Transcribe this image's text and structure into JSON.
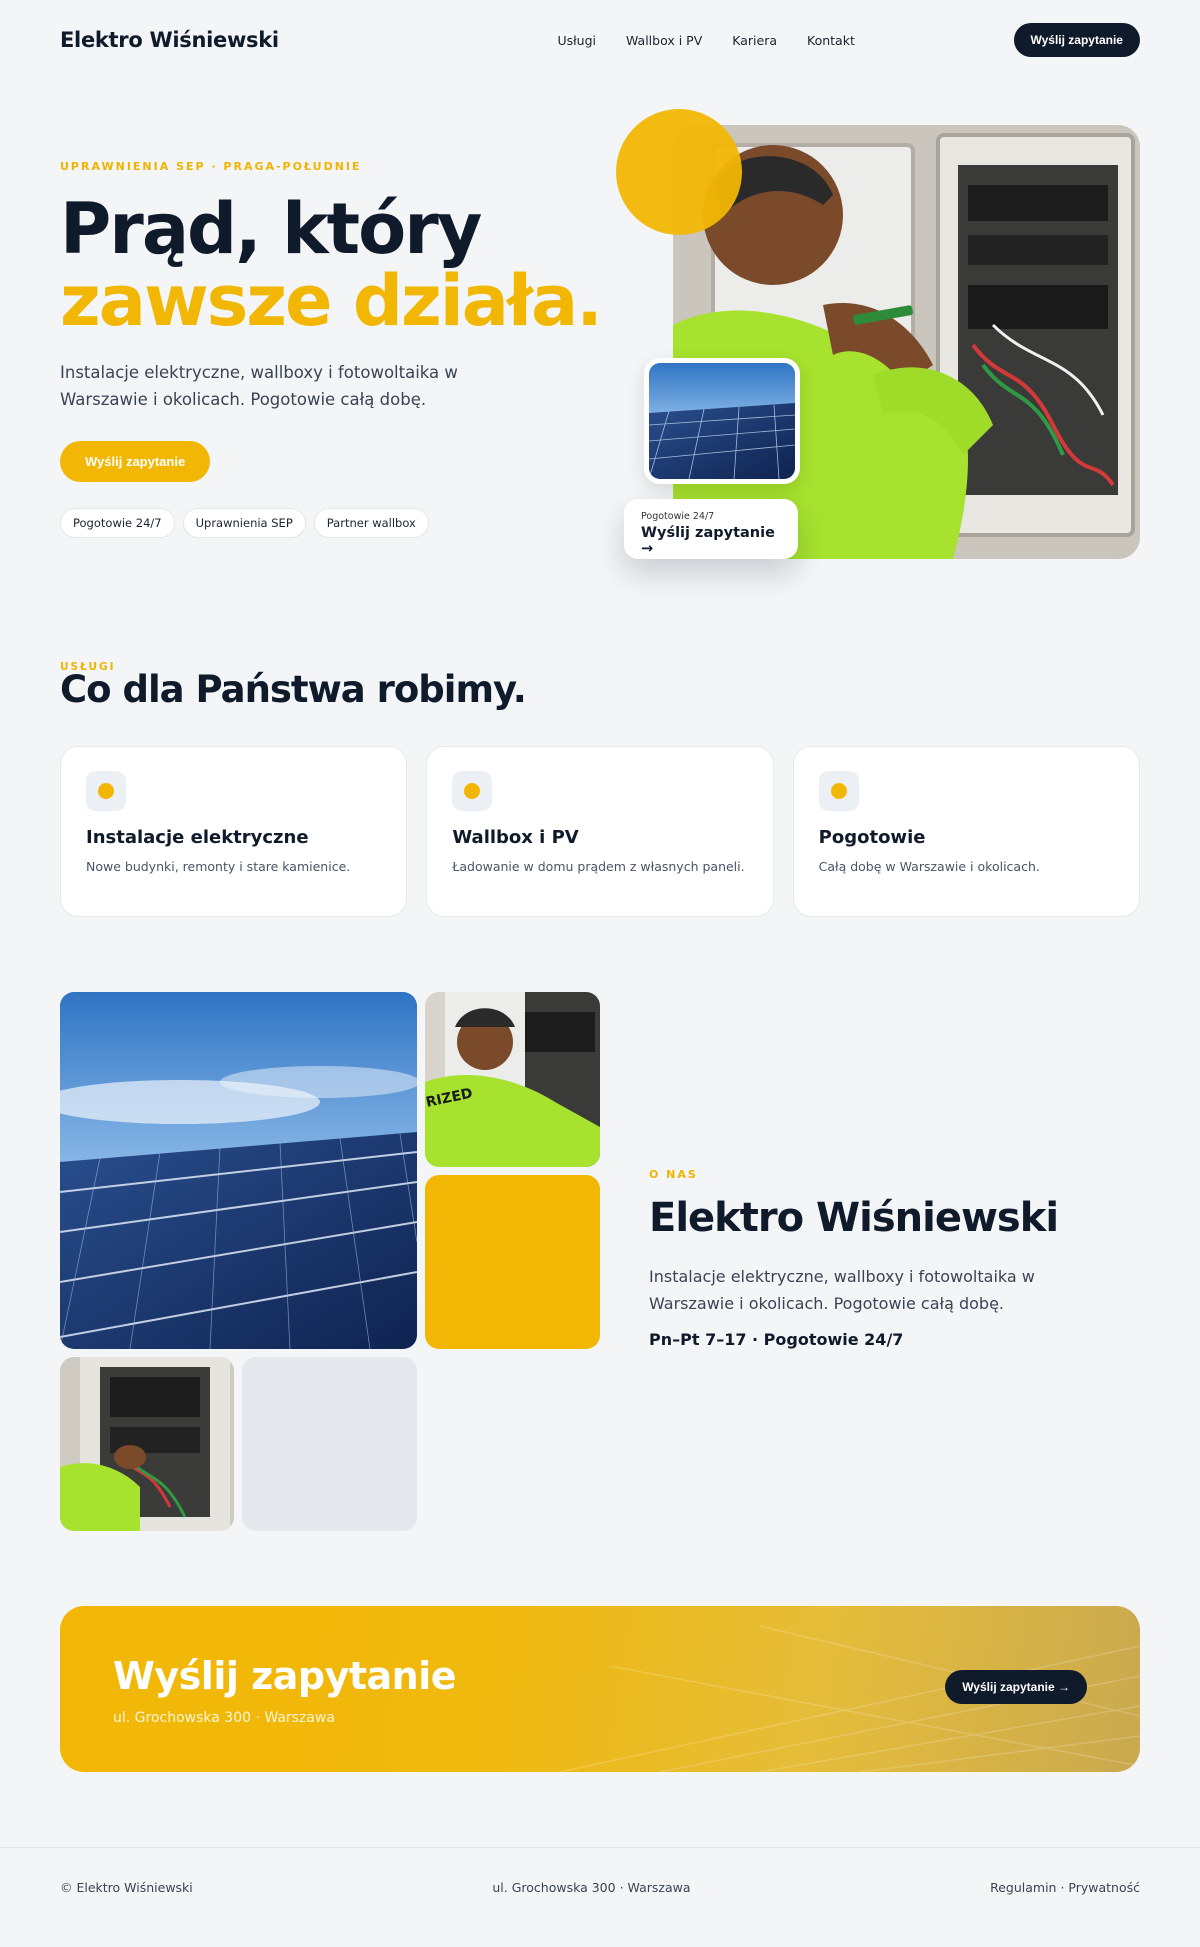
{
  "nav": {
    "brand": "Elektro Wiśniewski",
    "links": [
      "Usługi",
      "Wallbox i PV",
      "Kariera",
      "Kontakt"
    ],
    "cta": "Wyślij zapytanie"
  },
  "hero": {
    "eyebrow": "UPRAWNIENIA SEP · PRAGA-POŁUDNIE",
    "title_line1": "Prąd, który",
    "title_line2": "zawsze działa.",
    "lead": "Instalacje elektryczne, wallboxy i fotowoltaika w Warszawie i okolicach. Pogotowie całą dobę.",
    "button": "Wyślij zapytanie",
    "chips": [
      "Pogotowie 24/7",
      "Uprawnienia SEP",
      "Partner wallbox"
    ],
    "float_small": "Pogotowie 24/7",
    "float_big": "Wyślij zapytanie →"
  },
  "services": {
    "eyebrow": "USŁUGI",
    "title": "Co dla Państwa robimy.",
    "cards": [
      {
        "title": "Instalacje elektryczne",
        "desc": "Nowe budynki, remonty i stare kamienice."
      },
      {
        "title": "Wallbox i PV",
        "desc": "Ładowanie w domu prądem z własnych paneli."
      },
      {
        "title": "Pogotowie",
        "desc": "Całą dobę w Warszawie i okolicach."
      }
    ]
  },
  "about": {
    "eyebrow": "O NAS",
    "title": "Elektro Wiśniewski",
    "text": "Instalacje elektryczne, wallboxy i fotowoltaika w Warszawie i okolicach. Pogotowie całą dobę.",
    "hours": "Pn–Pt 7–17 · Pogotowie 24/7"
  },
  "cta": {
    "title": "Wyślij zapytanie",
    "address": "ul. Grochowska 300 · Warszawa",
    "button": "Wyślij zapytanie →"
  },
  "footer": {
    "copy": "© Elektro Wiśniewski",
    "address": "ul. Grochowska 300 · Warszawa",
    "legal": "Regulamin · Prywatność"
  },
  "colors": {
    "accent": "#f2b705",
    "dark": "#0f1a2b",
    "background": "#f3f5f7"
  }
}
